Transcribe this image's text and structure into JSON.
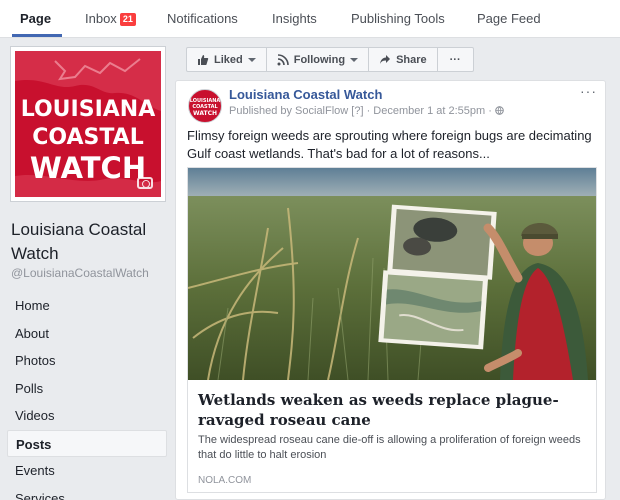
{
  "tabs": [
    {
      "label": "Page",
      "active": true
    },
    {
      "label": "Inbox",
      "badge": "21"
    },
    {
      "label": "Notifications"
    },
    {
      "label": "Insights"
    },
    {
      "label": "Publishing Tools"
    },
    {
      "label": "Page Feed"
    }
  ],
  "profile": {
    "logo_lines": [
      "LOUISIANA",
      "COASTAL",
      "WATCH"
    ],
    "name": "Louisiana Coastal Watch",
    "handle": "@LouisianaCoastalWatch"
  },
  "nav": [
    "Home",
    "About",
    "Photos",
    "Polls",
    "Videos",
    "Posts",
    "Events",
    "Services"
  ],
  "actions": {
    "liked": "Liked",
    "following": "Following",
    "share": "Share",
    "more": "···"
  },
  "post": {
    "author": "Louisiana Coastal Watch",
    "meta": "Published by SocialFlow [?] · December 1 at 2:55pm · ",
    "menu": "···",
    "text": "Flimsy foreign weeds are sprouting where foreign bugs are decimating Gulf coast wetlands. That's bad for a lot of reasons...",
    "link": {
      "title": "Wetlands weaken as weeds replace plague-ravaged roseau cane",
      "description": "The widespread roseau cane die-off is allowing a proliferation of foreign weeds that do little to halt erosion",
      "domain": "NOLA.COM"
    }
  },
  "colors": {
    "brand_red": "#c8102e",
    "link_blue": "#365899",
    "tab_accent": "#4267b2"
  }
}
